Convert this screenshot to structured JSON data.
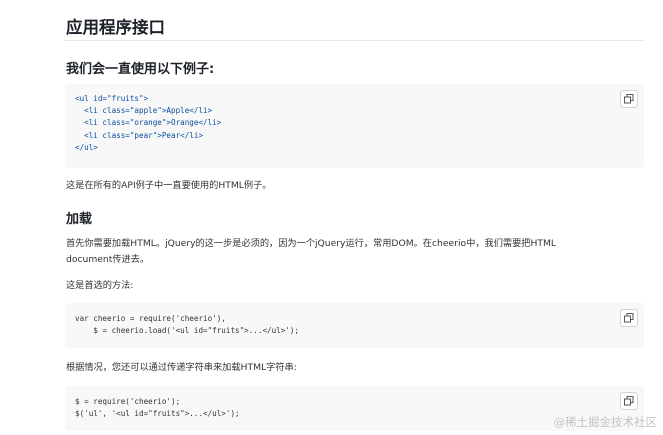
{
  "headings": {
    "api": "应用程序接口",
    "example_intro": "我们会一直使用以下例子:",
    "loading": "加载"
  },
  "code_blocks": {
    "html_example": [
      "<ul id=\"fruits\">",
      "  <li class=\"apple\">Apple</li>",
      "  <li class=\"orange\">Orange</li>",
      "  <li class=\"pear\">Pear</li>",
      "</ul>"
    ],
    "preferred": [
      "var cheerio = require('cheerio'),",
      "    $ = cheerio.load('<ul id=\"fruits\">...</ul>');"
    ],
    "string_load": [
      "$ = require('cheerio');",
      "$('ul', '<ul id=\"fruits\">...</ul>');"
    ]
  },
  "paragraphs": {
    "example_note": "这是在所有的API例子中一直要使用的HTML例子。",
    "load_line1": "首先你需要加载HTML。jQuery的这一步是必须的，因为一个jQuery运行，常用DOM。在cheerio中，我们需要把HTML",
    "load_line2": "document传进去。",
    "preferred_method": "这是首选的方法:",
    "string_method": "根据情况，您还可以通过传递字符串来加载HTML字符串:"
  },
  "watermark": "@稀土掘金技术社区",
  "icons": {
    "copy": "copy-icon"
  }
}
